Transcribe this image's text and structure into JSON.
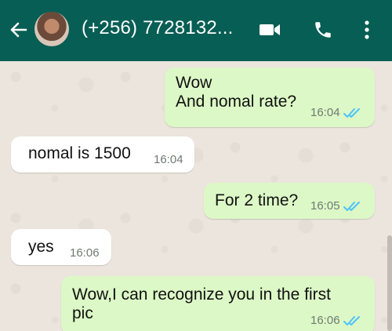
{
  "header": {
    "contact_name": "(+256) 7728132...",
    "bg_color": "#075e54",
    "icons": [
      "back-arrow-icon",
      "avatar",
      "video-call-icon",
      "voice-call-icon",
      "more-options-icon"
    ]
  },
  "messages": [
    {
      "direction": "outgoing",
      "lines": [
        "Wow",
        "And nomal rate?"
      ],
      "time": "16:04",
      "read": true
    },
    {
      "direction": "incoming",
      "lines": [
        "nomal is 1500"
      ],
      "time": "16:04"
    },
    {
      "direction": "outgoing",
      "lines": [
        "For 2 time?"
      ],
      "time": "16:05",
      "read": true
    },
    {
      "direction": "incoming",
      "lines": [
        "yes"
      ],
      "time": "16:06"
    },
    {
      "direction": "outgoing",
      "lines": [
        "Wow,I can recognize you in the first",
        "pic"
      ],
      "time": "16:06",
      "read": true
    }
  ],
  "colors": {
    "outgoing_bubble": "#dcf8c6",
    "incoming_bubble": "#ffffff",
    "read_ticks": "#4fc3f7",
    "chat_background": "#ece5dd"
  }
}
